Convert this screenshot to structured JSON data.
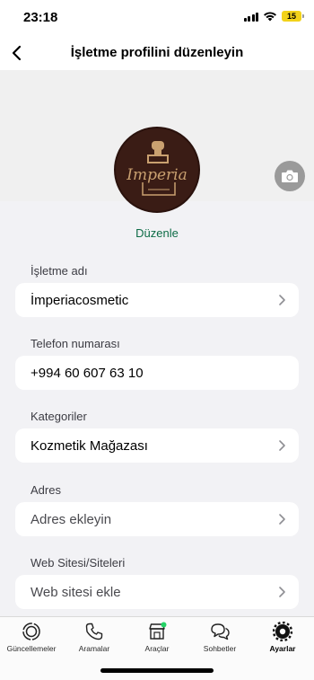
{
  "status_bar": {
    "time": "23:18",
    "battery": "15"
  },
  "header": {
    "title": "İşletme profilini düzenleyin"
  },
  "profile": {
    "logo_text": "Imperia",
    "edit_label": "Düzenle"
  },
  "fields": {
    "business_name": {
      "label": "İşletme adı",
      "value": "İmperiacosmetic"
    },
    "phone": {
      "label": "Telefon numarası",
      "value": "+994 60 607 63 10"
    },
    "category": {
      "label": "Kategoriler",
      "value": "Kozmetik Mağazası"
    },
    "address": {
      "label": "Adres",
      "placeholder": "Adres ekleyin"
    },
    "website": {
      "label": "Web Sitesi/Siteleri",
      "placeholder": "Web sitesi ekle"
    }
  },
  "tab_bar": {
    "tabs": [
      {
        "label": "Güncellemeler",
        "icon": "updates-icon"
      },
      {
        "label": "Aramalar",
        "icon": "phone-icon"
      },
      {
        "label": "Araçlar",
        "icon": "store-icon"
      },
      {
        "label": "Sohbetler",
        "icon": "chats-icon"
      },
      {
        "label": "Ayarlar",
        "icon": "settings-icon",
        "active": true
      }
    ]
  },
  "colors": {
    "accent": "#0c6b45",
    "badge": "#25d366",
    "battery": "#f2d21a"
  }
}
